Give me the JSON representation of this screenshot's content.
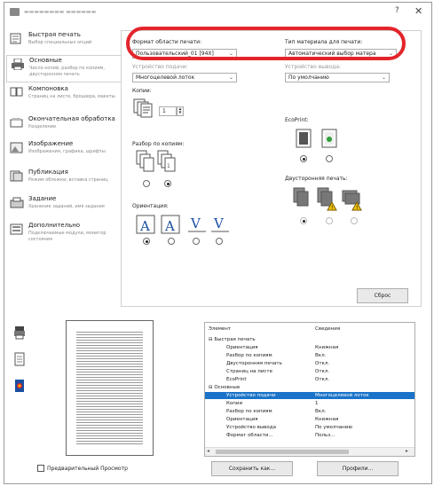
{
  "window": {
    "title": "▬▬▬▬▬▬▬▬ ▬▬▬▬▬▬",
    "help": "?",
    "close": "✕"
  },
  "nav": [
    {
      "title": "Быстрая печать",
      "sub": "Выбор специальных опций",
      "icon": "quick-print-icon"
    },
    {
      "title": "Основные",
      "sub": "Число копий, разбор по копиям, двусторонняя печать",
      "icon": "basic-icon"
    },
    {
      "title": "Компоновка",
      "sub": "Страниц на листе, брошюра, макеты",
      "icon": "layout-icon"
    },
    {
      "title": "Окончательная обработка",
      "sub": "Разделение",
      "icon": "finishing-icon"
    },
    {
      "title": "Изображение",
      "sub": "Изображения, графика, шрифты",
      "icon": "image-icon"
    },
    {
      "title": "Публикация",
      "sub": "Режим обложки, вставка страниц",
      "icon": "publishing-icon"
    },
    {
      "title": "Задание",
      "sub": "Хранение заданий, имя задания",
      "icon": "job-icon"
    },
    {
      "title": "Дополнительно",
      "sub": "Подключаемые модули, монитор состояния",
      "icon": "advanced-icon"
    }
  ],
  "basic": {
    "print_size_label": "Формат области печати:",
    "print_size_value": "Пользовательский_01 [94Х]",
    "media_type_label": "Тип материала для печати:",
    "media_type_value": "Автоматический выбор матера",
    "source_label": "Устройство подачи:",
    "source_value": "Многоцелевой лоток",
    "output_label": "Устройство вывода:",
    "output_value": "По умолчанию",
    "copies_label": "Копии:",
    "copies_value": "1",
    "collate_label": "Разбор по копиям:",
    "orientation_label": "Ориентация:",
    "ecoprint_label": "EcoPrint:",
    "duplex_label": "Двусторонняя печать:",
    "reset_button": "Сброс"
  },
  "summary": {
    "col_item": "Элемент",
    "col_info": "Сведения",
    "rows": [
      {
        "item": "⊟ Быстрая печать",
        "info": "",
        "level": 0
      },
      {
        "item": "Ориентация",
        "info": "Книжная",
        "level": 1
      },
      {
        "item": "Разбор по копиям",
        "info": "Вкл.",
        "level": 1
      },
      {
        "item": "Двусторонняя печать",
        "info": "Откл.",
        "level": 1
      },
      {
        "item": "Страниц на листе",
        "info": "Откл.",
        "level": 1
      },
      {
        "item": "EcoPrint",
        "info": "Откл.",
        "level": 1
      },
      {
        "item": "⊟ Основные",
        "info": "",
        "level": 0
      },
      {
        "item": "Устройство подачи",
        "info": "Многоцелевой лоток",
        "level": 1,
        "selected": true
      },
      {
        "item": "Копии",
        "info": "1",
        "level": 1
      },
      {
        "item": "Разбор по копиям",
        "info": "Вкл.",
        "level": 1
      },
      {
        "item": "Ориентация",
        "info": "Книжная",
        "level": 1
      },
      {
        "item": "Устройство вывода",
        "info": "По умолчанию",
        "level": 1
      },
      {
        "item": "Формат области...",
        "info": "Польз...",
        "level": 1
      }
    ]
  },
  "footer": {
    "preview_label": "Предварительный Просмотр",
    "save_button": "Сохранить как...",
    "profiles_button": "Профили..."
  },
  "highlight_color": "#e3252b",
  "selection_color": "#1a73c9"
}
